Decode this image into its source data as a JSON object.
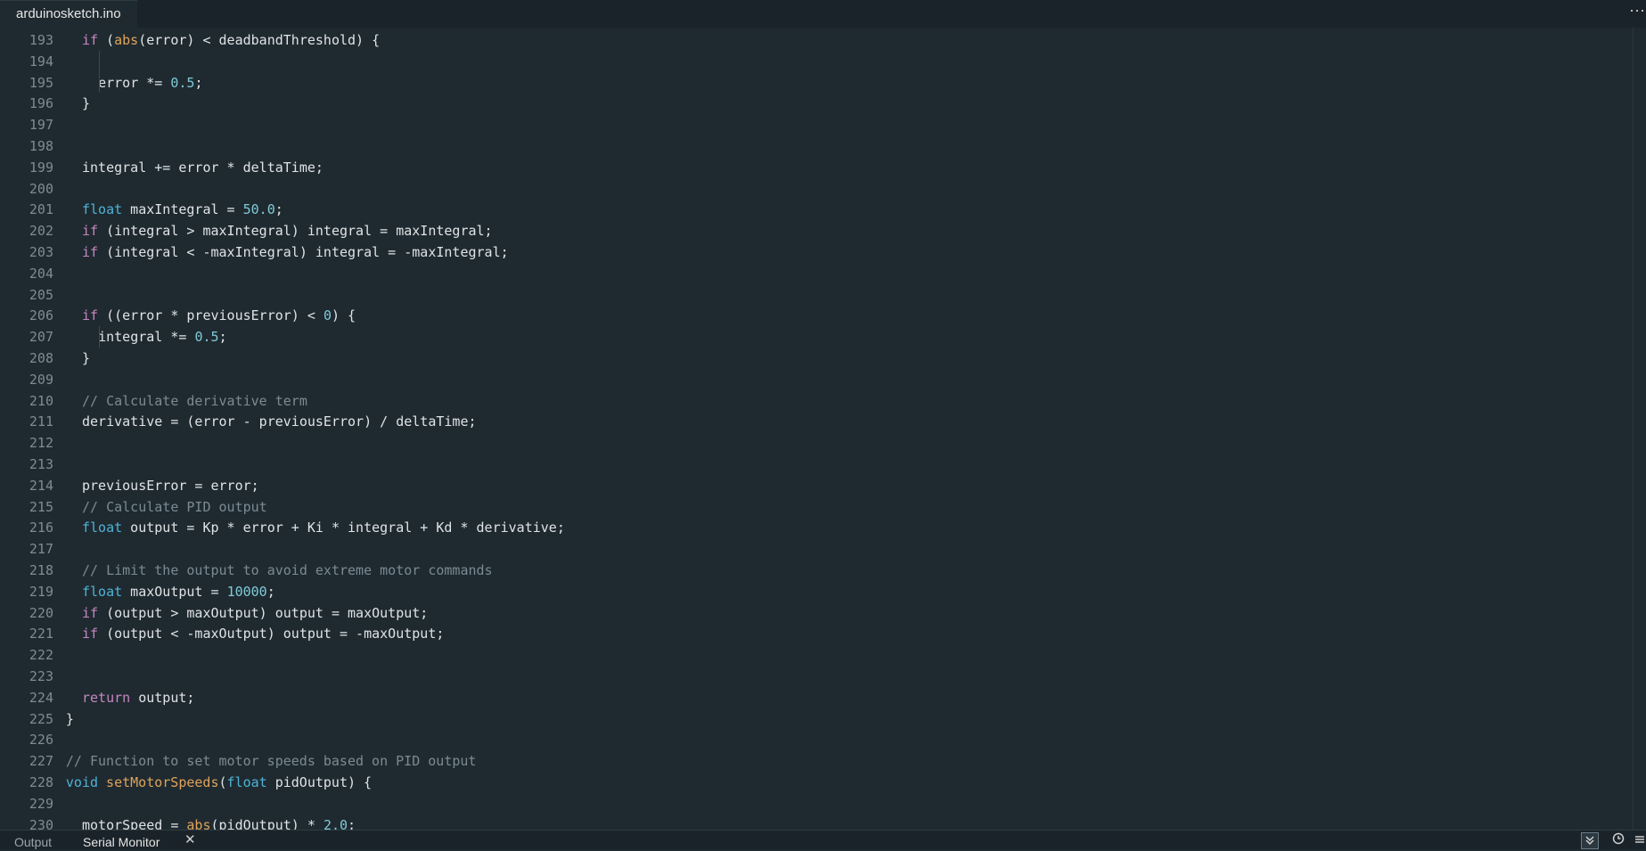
{
  "tab": {
    "filename": "arduinosketch.ino",
    "more_icon": "ellipsis-icon"
  },
  "code_lines": [
    {
      "n": "193",
      "indent": 2,
      "tokens": [
        [
          "kw",
          "if"
        ],
        [
          "p",
          " ("
        ],
        [
          "fn",
          "abs"
        ],
        [
          "p",
          "(error) < deadbandThreshold) {"
        ]
      ]
    },
    {
      "n": "194",
      "indent": 2,
      "tokens": []
    },
    {
      "n": "195",
      "indent": 4,
      "tokens": [
        [
          "p",
          "error *= "
        ],
        [
          "num",
          "0.5"
        ],
        [
          "p",
          ";"
        ]
      ]
    },
    {
      "n": "196",
      "indent": 2,
      "tokens": [
        [
          "p",
          "}"
        ]
      ]
    },
    {
      "n": "197",
      "indent": 2,
      "tokens": []
    },
    {
      "n": "198",
      "indent": 2,
      "tokens": []
    },
    {
      "n": "199",
      "indent": 2,
      "tokens": [
        [
          "p",
          "integral += error * deltaTime;"
        ]
      ]
    },
    {
      "n": "200",
      "indent": 2,
      "tokens": []
    },
    {
      "n": "201",
      "indent": 2,
      "tokens": [
        [
          "ty",
          "float"
        ],
        [
          "p",
          " maxIntegral = "
        ],
        [
          "num",
          "50.0"
        ],
        [
          "p",
          ";"
        ]
      ]
    },
    {
      "n": "202",
      "indent": 2,
      "tokens": [
        [
          "kw",
          "if"
        ],
        [
          "p",
          " (integral > maxIntegral) integral = maxIntegral;"
        ]
      ]
    },
    {
      "n": "203",
      "indent": 2,
      "tokens": [
        [
          "kw",
          "if"
        ],
        [
          "p",
          " (integral < -maxIntegral) integral = -maxIntegral;"
        ]
      ]
    },
    {
      "n": "204",
      "indent": 2,
      "tokens": []
    },
    {
      "n": "205",
      "indent": 2,
      "tokens": []
    },
    {
      "n": "206",
      "indent": 2,
      "tokens": [
        [
          "kw",
          "if"
        ],
        [
          "p",
          " ((error * previousError) < "
        ],
        [
          "num",
          "0"
        ],
        [
          "p",
          ") {"
        ]
      ]
    },
    {
      "n": "207",
      "indent": 4,
      "tokens": [
        [
          "p",
          "integral *= "
        ],
        [
          "num",
          "0.5"
        ],
        [
          "p",
          ";"
        ]
      ]
    },
    {
      "n": "208",
      "indent": 2,
      "tokens": [
        [
          "p",
          "}"
        ]
      ]
    },
    {
      "n": "209",
      "indent": 2,
      "tokens": []
    },
    {
      "n": "210",
      "indent": 2,
      "tokens": [
        [
          "cm",
          "// Calculate derivative term"
        ]
      ]
    },
    {
      "n": "211",
      "indent": 2,
      "tokens": [
        [
          "p",
          "derivative = (error - previousError) / deltaTime;"
        ]
      ]
    },
    {
      "n": "212",
      "indent": 2,
      "tokens": []
    },
    {
      "n": "213",
      "indent": 2,
      "tokens": []
    },
    {
      "n": "214",
      "indent": 2,
      "tokens": [
        [
          "p",
          "previousError = error;"
        ]
      ]
    },
    {
      "n": "215",
      "indent": 2,
      "tokens": [
        [
          "cm",
          "// Calculate PID output"
        ]
      ]
    },
    {
      "n": "216",
      "indent": 2,
      "tokens": [
        [
          "ty",
          "float"
        ],
        [
          "p",
          " output = Kp * error + Ki * integral + Kd * derivative;"
        ]
      ]
    },
    {
      "n": "217",
      "indent": 2,
      "tokens": []
    },
    {
      "n": "218",
      "indent": 2,
      "tokens": [
        [
          "cm",
          "// Limit the output to avoid extreme motor commands"
        ]
      ]
    },
    {
      "n": "219",
      "indent": 2,
      "tokens": [
        [
          "ty",
          "float"
        ],
        [
          "p",
          " maxOutput = "
        ],
        [
          "num",
          "10000"
        ],
        [
          "p",
          ";"
        ]
      ]
    },
    {
      "n": "220",
      "indent": 2,
      "tokens": [
        [
          "kw",
          "if"
        ],
        [
          "p",
          " (output > maxOutput) output = maxOutput;"
        ]
      ]
    },
    {
      "n": "221",
      "indent": 2,
      "tokens": [
        [
          "kw",
          "if"
        ],
        [
          "p",
          " (output < -maxOutput) output = -maxOutput;"
        ]
      ]
    },
    {
      "n": "222",
      "indent": 2,
      "tokens": []
    },
    {
      "n": "223",
      "indent": 2,
      "tokens": []
    },
    {
      "n": "224",
      "indent": 2,
      "tokens": [
        [
          "kw",
          "return"
        ],
        [
          "p",
          " output;"
        ]
      ]
    },
    {
      "n": "225",
      "indent": 0,
      "tokens": [
        [
          "p",
          "}"
        ]
      ]
    },
    {
      "n": "226",
      "indent": 0,
      "tokens": []
    },
    {
      "n": "227",
      "indent": 0,
      "tokens": [
        [
          "cm",
          "// Function to set motor speeds based on PID output"
        ]
      ]
    },
    {
      "n": "228",
      "indent": 0,
      "tokens": [
        [
          "ty",
          "void"
        ],
        [
          "p",
          " "
        ],
        [
          "fn",
          "setMotorSpeeds"
        ],
        [
          "p",
          "("
        ],
        [
          "ty",
          "float"
        ],
        [
          "p",
          " pidOutput) {"
        ]
      ]
    },
    {
      "n": "229",
      "indent": 2,
      "tokens": []
    },
    {
      "n": "230",
      "indent": 2,
      "tokens": [
        [
          "p",
          "motorSpeed = "
        ],
        [
          "fn",
          "abs"
        ],
        [
          "p",
          "(pidOutput) * "
        ],
        [
          "num",
          "2.0"
        ],
        [
          "p",
          ";"
        ]
      ]
    }
  ],
  "bottom_panel": {
    "tabs": [
      {
        "label": "Output"
      },
      {
        "label": "Serial Monitor"
      }
    ],
    "close_glyph": "✕",
    "icons": [
      "double-chevron-down-icon",
      "clock-icon",
      "menu-lines-icon"
    ]
  },
  "colors": {
    "background": "#1f2a30",
    "keyword": "#c586c0",
    "type": "#4fb3d6",
    "number": "#7fcbd8",
    "function": "#e0a35b",
    "comment": "#7b8a93"
  }
}
